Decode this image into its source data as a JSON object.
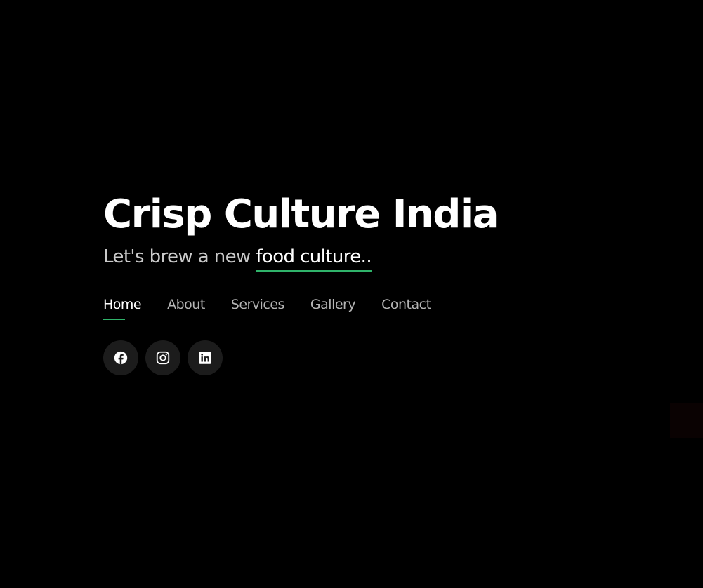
{
  "hero": {
    "title": "Crisp Culture India",
    "subtitle_prefix": "Let's brew a new ",
    "subtitle_highlight": "food culture.."
  },
  "nav": {
    "items": [
      {
        "label": "Home",
        "active": true
      },
      {
        "label": "About",
        "active": false
      },
      {
        "label": "Services",
        "active": false
      },
      {
        "label": "Gallery",
        "active": false
      },
      {
        "label": "Contact",
        "active": false
      }
    ]
  },
  "socials": [
    {
      "icon": "facebook-icon"
    },
    {
      "icon": "instagram-icon"
    },
    {
      "icon": "linkedin-icon"
    }
  ],
  "colors": {
    "background": "#000000",
    "accent": "#2fb36a",
    "text_primary": "#ffffff",
    "text_muted": "#b5b5b5",
    "social_bg": "#1c1c1c"
  }
}
